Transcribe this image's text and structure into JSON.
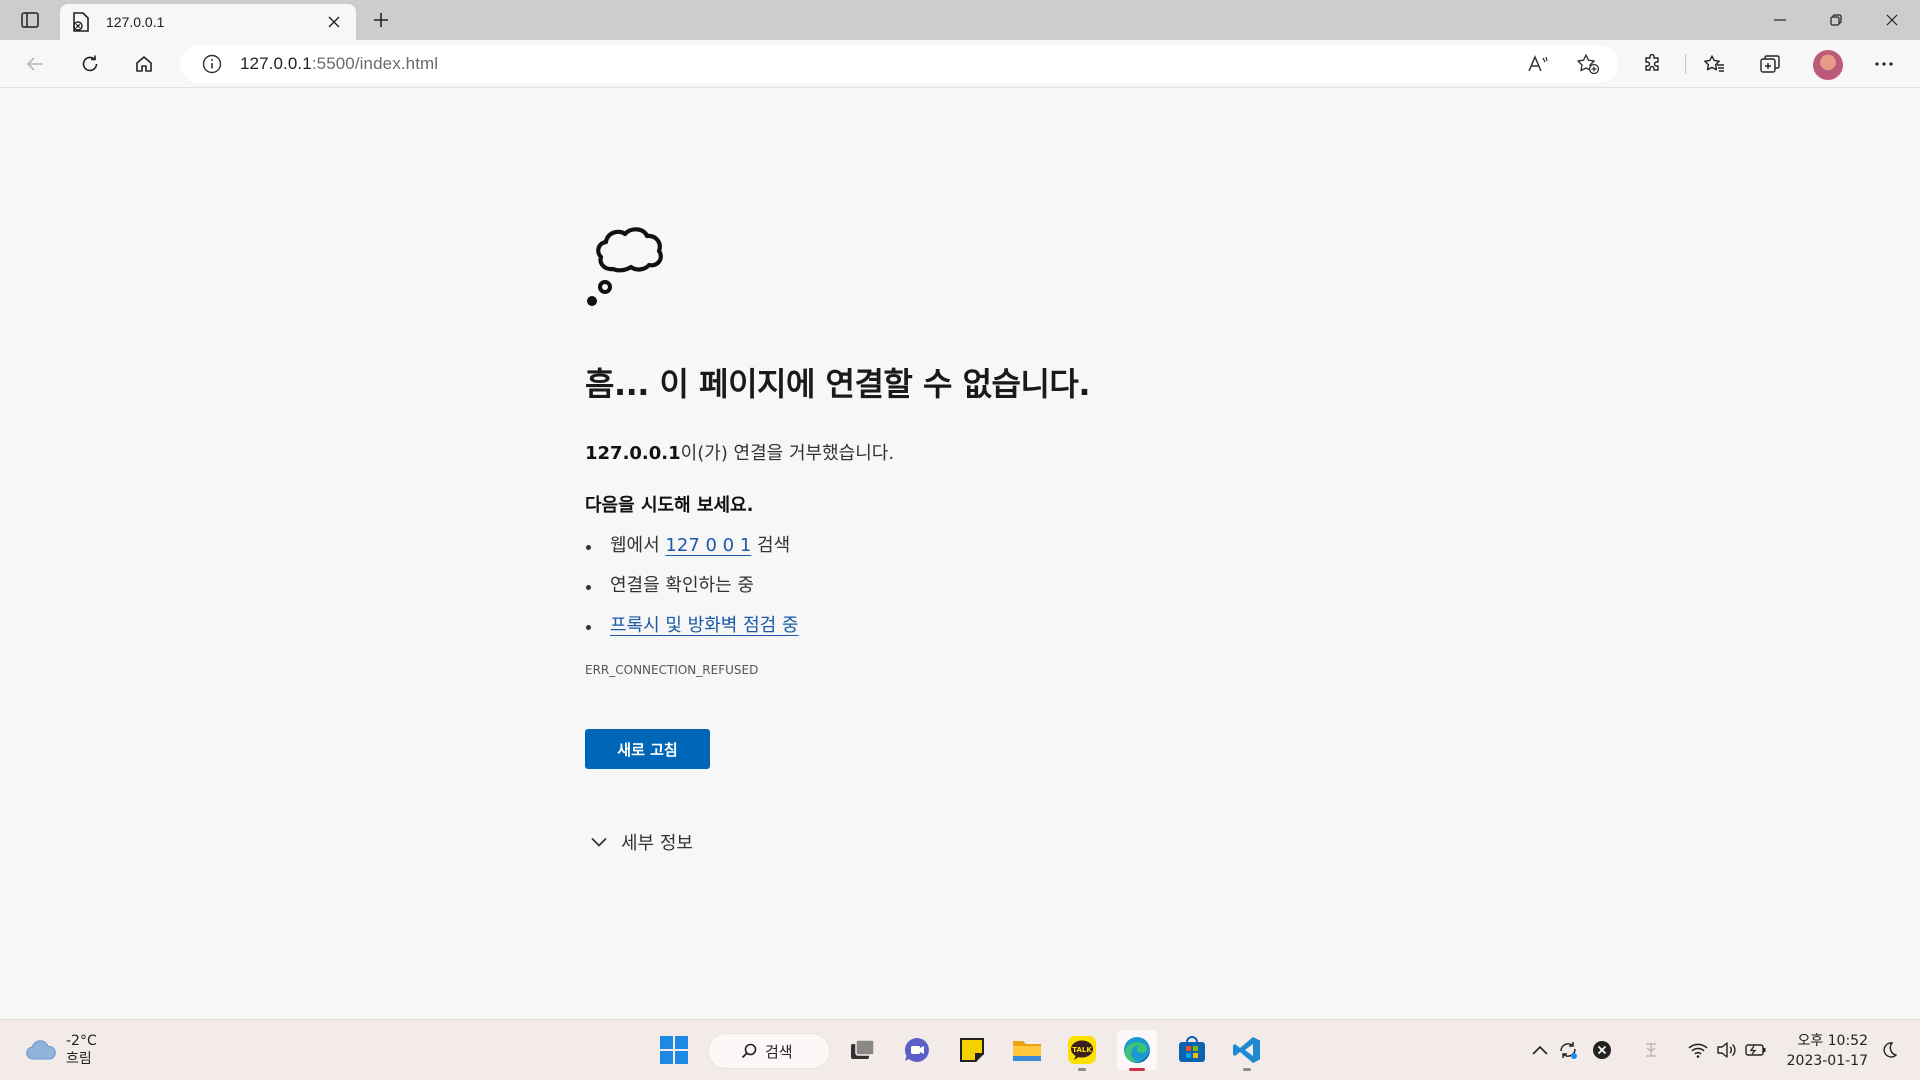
{
  "browser": {
    "tab": {
      "title": "127.0.0.1",
      "favicon": "broken-page-icon"
    },
    "address": {
      "host": "127.0.0.1",
      "rest": ":5500/index.html"
    },
    "icons": {
      "tab_actions": "tab-actions-icon",
      "close_tab": "close-icon",
      "new_tab": "plus-icon",
      "back": "back-arrow-icon",
      "refresh": "refresh-icon",
      "home": "home-icon",
      "info": "info-icon",
      "read_aloud": "read-aloud-icon",
      "add_favorite": "add-favorite-icon",
      "extensions": "puzzle-icon",
      "favorites": "favorites-icon",
      "collections": "collections-icon",
      "more": "more-icon"
    }
  },
  "error_page": {
    "icon": "thought-cloud-icon",
    "title": "흠... 이 페이지에 연결할 수 없습니다.",
    "desc_host": "127.0.0.1",
    "desc_rest": "이(가) 연결을 거부했습니다.",
    "try_heading": "다음을 시도해 보세요.",
    "suggestions": {
      "web_search_prefix": "웹에서",
      "web_search_link": "127 0 0 1",
      "web_search_suffix": "검색",
      "check_connection": "연결을 확인하는 중",
      "proxy_link": "프록시 및 방화벽 점검 중"
    },
    "error_code": "ERR_CONNECTION_REFUSED",
    "reload_button": "새로 고침",
    "details_label": "세부 정보",
    "accent_color": "#0067b8"
  },
  "taskbar": {
    "weather": {
      "temp": "-2°C",
      "condition": "흐림"
    },
    "search_label": "검색",
    "apps": [
      "windows-start-icon",
      "task-view-icon",
      "chat-icon",
      "sticky-notes-icon",
      "file-explorer-icon",
      "kakaotalk-icon",
      "edge-icon",
      "store-icon",
      "vscode-icon"
    ],
    "kakao_label": "TALK",
    "clock": {
      "time": "오후 10:52",
      "date": "2023-01-17"
    }
  }
}
